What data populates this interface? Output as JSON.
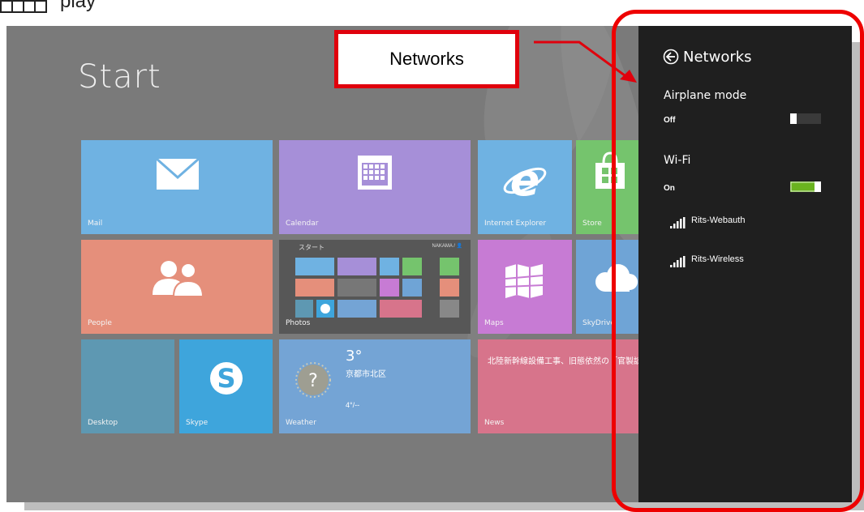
{
  "header_label": "play",
  "start_title": "Start",
  "tiles": {
    "mail": {
      "label": "Mail",
      "color": "#6fb2e2"
    },
    "calendar": {
      "label": "Calendar",
      "color": "#a68fd8"
    },
    "ie": {
      "label": "Internet Explorer",
      "color": "#6fb2e2"
    },
    "store": {
      "label": "Store",
      "color": "#75c46d"
    },
    "people": {
      "label": "People",
      "color": "#e58f7b"
    },
    "photos": {
      "label": "Photos",
      "color": "#575757",
      "inner_title": "スタート",
      "inner_user": "NAKAMA / 👤"
    },
    "maps": {
      "label": "Maps",
      "color": "#c77bd4"
    },
    "skydrive": {
      "label": "SkyDrive",
      "color": "#6fa4d6"
    },
    "desktop": {
      "label": "Desktop",
      "color": "#5e98b2"
    },
    "skype": {
      "label": "Skype",
      "color": "#3ea5dc"
    },
    "weather": {
      "label": "Weather",
      "color": "#74a4d5",
      "temp": "3°",
      "location": "京都市北区",
      "range": "4°/--"
    },
    "news": {
      "label": "News",
      "color": "#d7748b",
      "headline": "北陸新幹線設備工事、旧態依然の「官製談合」"
    }
  },
  "networks_panel": {
    "title": "Networks",
    "airplane": {
      "title": "Airplane mode",
      "state": "Off",
      "on": false
    },
    "wifi": {
      "title": "Wi-Fi",
      "state": "On",
      "on": true
    },
    "networks": [
      {
        "name": "Rits-Webauth"
      },
      {
        "name": "Rits-Wireless"
      }
    ],
    "accent": "#6ab31f"
  },
  "callout": {
    "label": "Networks",
    "color": "#e0000c"
  }
}
